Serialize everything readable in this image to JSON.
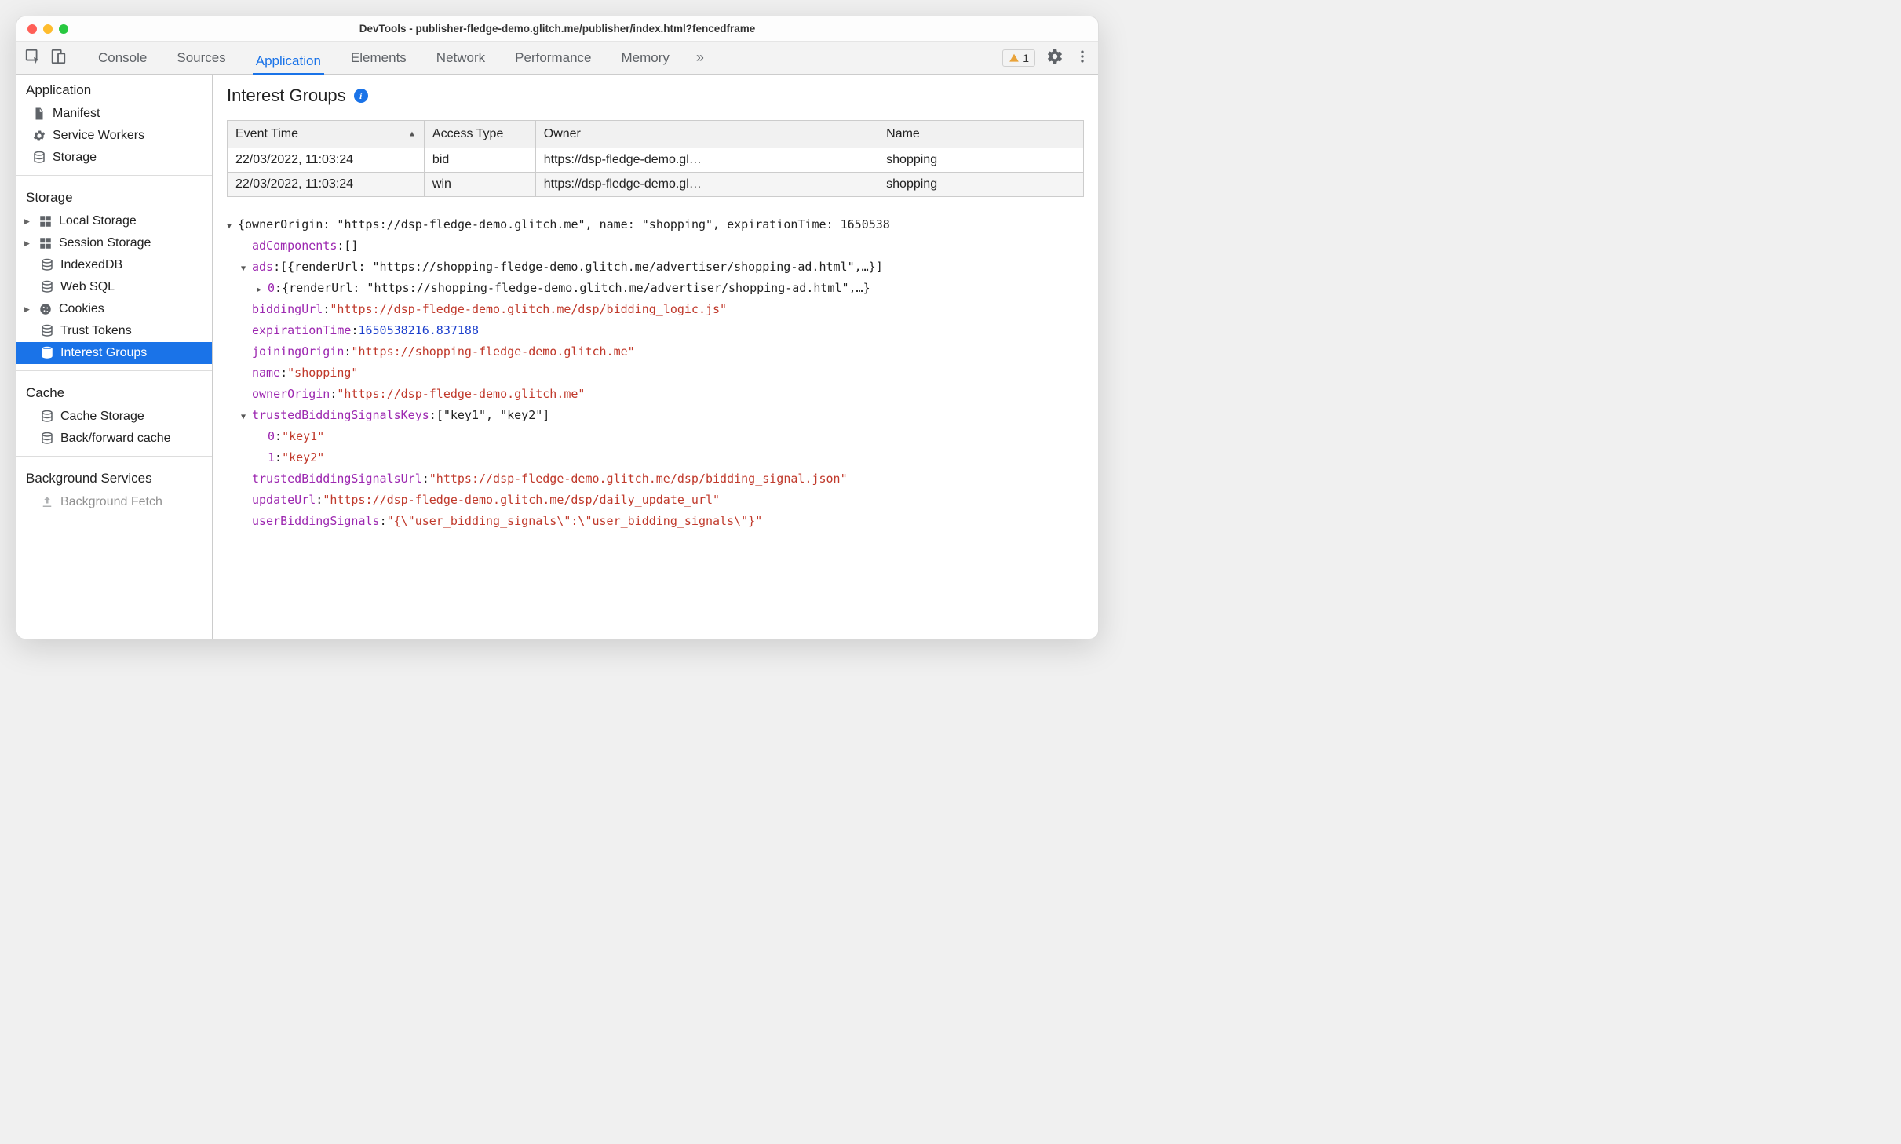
{
  "window": {
    "title": "DevTools - publisher-fledge-demo.glitch.me/publisher/index.html?fencedframe"
  },
  "toolbar": {
    "tabs": [
      "Console",
      "Sources",
      "Application",
      "Elements",
      "Network",
      "Performance",
      "Memory"
    ],
    "active_tab_index": 2,
    "warning_count": "1"
  },
  "sidebar": {
    "sections": [
      {
        "title": "Application",
        "items": [
          {
            "label": "Manifest",
            "icon": "file-icon"
          },
          {
            "label": "Service Workers",
            "icon": "gear-icon"
          },
          {
            "label": "Storage",
            "icon": "db-icon"
          }
        ]
      },
      {
        "title": "Storage",
        "items": [
          {
            "label": "Local Storage",
            "icon": "grid-icon",
            "expandable": true
          },
          {
            "label": "Session Storage",
            "icon": "grid-icon",
            "expandable": true
          },
          {
            "label": "IndexedDB",
            "icon": "db-icon"
          },
          {
            "label": "Web SQL",
            "icon": "db-icon"
          },
          {
            "label": "Cookies",
            "icon": "cookie-icon",
            "expandable": true
          },
          {
            "label": "Trust Tokens",
            "icon": "db-icon"
          },
          {
            "label": "Interest Groups",
            "icon": "db-icon",
            "selected": true
          }
        ]
      },
      {
        "title": "Cache",
        "items": [
          {
            "label": "Cache Storage",
            "icon": "db-icon"
          },
          {
            "label": "Back/forward cache",
            "icon": "db-icon"
          }
        ]
      },
      {
        "title": "Background Services",
        "items": [
          {
            "label": "Background Fetch",
            "icon": "upload-icon"
          }
        ]
      }
    ]
  },
  "content": {
    "title": "Interest Groups",
    "table": {
      "columns": [
        "Event Time",
        "Access Type",
        "Owner",
        "Name"
      ],
      "sort_col_index": 0,
      "rows": [
        {
          "event_time": "22/03/2022, 11:03:24",
          "access_type": "bid",
          "owner": "https://dsp-fledge-demo.gl…",
          "name": "shopping"
        },
        {
          "event_time": "22/03/2022, 11:03:24",
          "access_type": "win",
          "owner": "https://dsp-fledge-demo.gl…",
          "name": "shopping"
        }
      ]
    },
    "detail": {
      "header": "{ownerOrigin: \"https://dsp-fledge-demo.glitch.me\", name: \"shopping\", expirationTime: 1650538",
      "adComponents": "[]",
      "ads_summary": "[{renderUrl: \"https://shopping-fledge-demo.glitch.me/advertiser/shopping-ad.html\",…}]",
      "ads_item0": "{renderUrl: \"https://shopping-fledge-demo.glitch.me/advertiser/shopping-ad.html\",…}",
      "biddingUrl": "\"https://dsp-fledge-demo.glitch.me/dsp/bidding_logic.js\"",
      "expirationTime": "1650538216.837188",
      "joiningOrigin": "\"https://shopping-fledge-demo.glitch.me\"",
      "name": "\"shopping\"",
      "ownerOrigin": "\"https://dsp-fledge-demo.glitch.me\"",
      "trustedBiddingSignalsKeys_summary": "[\"key1\", \"key2\"]",
      "trustedBiddingSignalsKeys_0": "\"key1\"",
      "trustedBiddingSignalsKeys_1": "\"key2\"",
      "trustedBiddingSignalsUrl": "\"https://dsp-fledge-demo.glitch.me/dsp/bidding_signal.json\"",
      "updateUrl": "\"https://dsp-fledge-demo.glitch.me/dsp/daily_update_url\"",
      "userBiddingSignals": "\"{\\\"user_bidding_signals\\\":\\\"user_bidding_signals\\\"}\""
    }
  }
}
